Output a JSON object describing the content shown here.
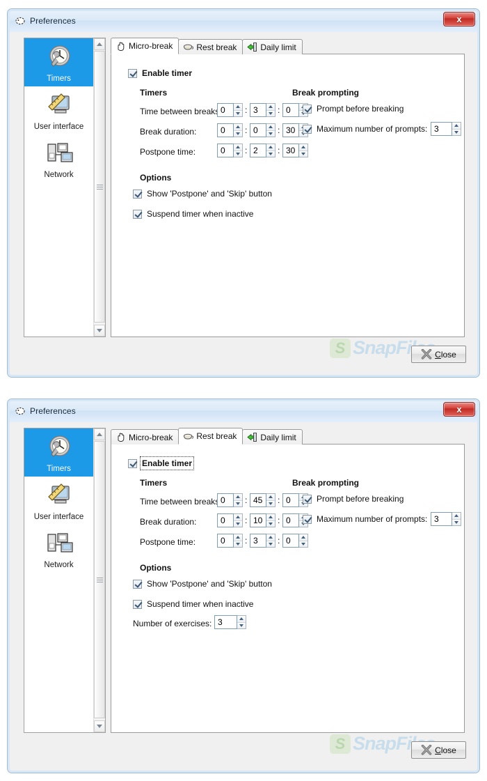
{
  "windows": [
    {
      "title": "Preferences",
      "title_icon": "preferences-icon",
      "close_glyph": "x",
      "sidebar": {
        "items": [
          {
            "label": "Timers",
            "icon": "clock-wrench-icon",
            "selected": true
          },
          {
            "label": "User interface",
            "icon": "monitor-ruler-icon",
            "selected": false
          },
          {
            "label": "Network",
            "icon": "network-computers-icon",
            "selected": false
          }
        ]
      },
      "tabs": [
        {
          "label": "Micro-break",
          "icon": "hand-icon",
          "active": true
        },
        {
          "label": "Rest break",
          "icon": "coffee-cup-icon",
          "active": false
        },
        {
          "label": "Daily limit",
          "icon": "green-exit-arrow-icon",
          "active": false
        }
      ],
      "enable_timer": {
        "label": "Enable timer",
        "checked": true,
        "focused": false
      },
      "timers": {
        "heading": "Timers",
        "rows": [
          {
            "label": "Time between breaks:",
            "h": "0",
            "m": "3",
            "s": "0"
          },
          {
            "label": "Break duration:",
            "h": "0",
            "m": "0",
            "s": "30"
          },
          {
            "label": "Postpone time:",
            "h": "0",
            "m": "2",
            "s": "30"
          }
        ]
      },
      "break_prompting": {
        "heading": "Break prompting",
        "prompt_before": {
          "label": "Prompt before breaking",
          "checked": true
        },
        "max_prompts": {
          "label": "Maximum number of prompts:",
          "checked": true,
          "value": "3"
        }
      },
      "options": {
        "heading": "Options",
        "show_postpone": {
          "label": "Show 'Postpone' and 'Skip' button",
          "checked": true
        },
        "suspend_inactive": {
          "label": "Suspend timer when inactive",
          "checked": true
        },
        "num_exercises": null
      },
      "close_button": {
        "label": "Close",
        "accel": "C",
        "icon": "x-mark-icon"
      },
      "watermark": {
        "logo": "S",
        "text": "SnapFiles"
      }
    },
    {
      "title": "Preferences",
      "title_icon": "preferences-icon",
      "close_glyph": "x",
      "sidebar": {
        "items": [
          {
            "label": "Timers",
            "icon": "clock-wrench-icon",
            "selected": true
          },
          {
            "label": "User interface",
            "icon": "monitor-ruler-icon",
            "selected": false
          },
          {
            "label": "Network",
            "icon": "network-computers-icon",
            "selected": false
          }
        ]
      },
      "tabs": [
        {
          "label": "Micro-break",
          "icon": "hand-icon",
          "active": false
        },
        {
          "label": "Rest break",
          "icon": "coffee-cup-icon",
          "active": true
        },
        {
          "label": "Daily limit",
          "icon": "green-exit-arrow-icon",
          "active": false
        }
      ],
      "enable_timer": {
        "label": "Enable timer",
        "checked": true,
        "focused": true
      },
      "timers": {
        "heading": "Timers",
        "rows": [
          {
            "label": "Time between breaks:",
            "h": "0",
            "m": "45",
            "s": "0"
          },
          {
            "label": "Break duration:",
            "h": "0",
            "m": "10",
            "s": "0"
          },
          {
            "label": "Postpone time:",
            "h": "0",
            "m": "3",
            "s": "0"
          }
        ]
      },
      "break_prompting": {
        "heading": "Break prompting",
        "prompt_before": {
          "label": "Prompt before breaking",
          "checked": true
        },
        "max_prompts": {
          "label": "Maximum number of prompts:",
          "checked": true,
          "value": "3"
        }
      },
      "options": {
        "heading": "Options",
        "show_postpone": {
          "label": "Show 'Postpone' and 'Skip' button",
          "checked": true
        },
        "suspend_inactive": {
          "label": "Suspend timer when inactive",
          "checked": true
        },
        "num_exercises": {
          "label": "Number of exercises:",
          "value": "3"
        }
      },
      "close_button": {
        "label": "Close",
        "accel": "C",
        "icon": "x-mark-icon"
      },
      "watermark": {
        "logo": "S",
        "text": "SnapFiles"
      }
    }
  ]
}
